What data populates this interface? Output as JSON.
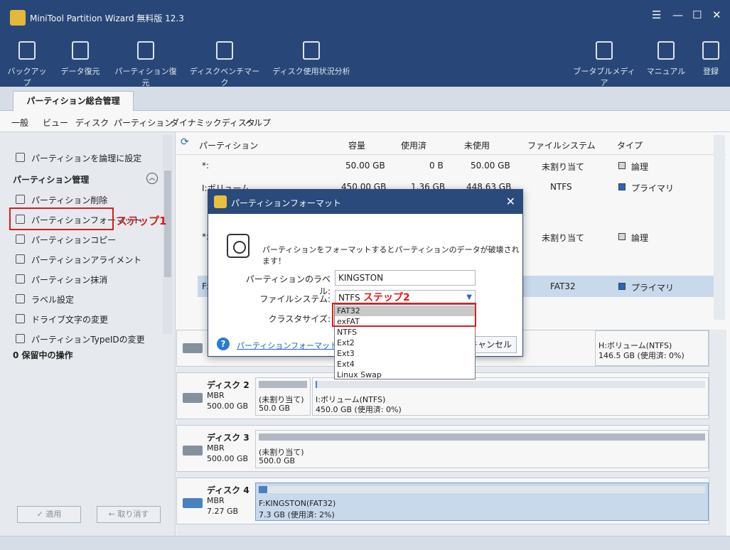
{
  "app": {
    "title": "MiniTool Partition Wizard 無料版 12.3"
  },
  "toolbar": {
    "items": [
      {
        "label": "バックアップ",
        "icon": "backup-icon"
      },
      {
        "label": "データ復元",
        "icon": "data-recovery-icon"
      },
      {
        "label": "パーティション復元",
        "icon": "partition-recovery-icon"
      },
      {
        "label": "ディスクベンチマーク",
        "icon": "disk-benchmark-icon"
      },
      {
        "label": "ディスク使用状況分析",
        "icon": "space-analyzer-icon"
      }
    ],
    "right_items": [
      {
        "label": "ブータブルメディア",
        "icon": "bootable-media-icon"
      },
      {
        "label": "マニュアル",
        "icon": "manual-icon"
      },
      {
        "label": "登録",
        "icon": "register-icon"
      }
    ]
  },
  "tabs": [
    {
      "label": "パーティション総合管理"
    }
  ],
  "menu": [
    "一般",
    "ビュー",
    "ディスク",
    "パーティション",
    "ダイナミックディスク",
    "ヘルプ"
  ],
  "sidebar": {
    "top_items": [
      "パーティションを論理に設定"
    ],
    "section_title": "パーティション管理",
    "items": [
      "パーティション削除",
      "パーティションフォーマット",
      "パーティションコピー",
      "パーティションアライメント",
      "パーティション抹消",
      "ラベル設定",
      "ドライブ文字の変更",
      "パーティションTypeIDの変更"
    ],
    "pending": "0 保留中の操作",
    "apply_label": "✓ 適用",
    "undo_label": "← 取り消す"
  },
  "annotations": {
    "step1": "ステップ1",
    "step2": "ステップ2"
  },
  "grid": {
    "headers": [
      "パーティション",
      "容量",
      "使用済",
      "未使用",
      "ファイルシステム",
      "タイプ"
    ],
    "rows": [
      {
        "name": "*:",
        "cap": "50.00 GB",
        "used": "0 B",
        "free": "50.00 GB",
        "fs": "未割り当て",
        "type": "論理"
      },
      {
        "name": "I:ボリューム",
        "cap": "450.00 GB",
        "used": "1.36 GB",
        "free": "448.63 GB",
        "fs": "NTFS",
        "type": "プライマリ"
      },
      {
        "name": "*:",
        "cap": "",
        "used": "",
        "free": "",
        "fs": "未割り当て",
        "type": "論理"
      },
      {
        "name": "F:",
        "cap": "",
        "used": "",
        "free": "",
        "fs": "FAT32",
        "type": "プライマリ"
      }
    ]
  },
  "disks": [
    {
      "name": "",
      "sub": "",
      "parts": [
        {
          "l1": "H:ボリューム(NTFS)",
          "l2": "146.5 GB (使用済: 0%)"
        }
      ]
    },
    {
      "name": "ディスク 2",
      "sub1": "MBR",
      "sub2": "500.00 GB",
      "parts": [
        {
          "l1": "(未割り当て)",
          "l2": "50.0 GB"
        },
        {
          "l1": "I:ボリューム(NTFS)",
          "l2": "450.0 GB (使用済: 0%)"
        }
      ]
    },
    {
      "name": "ディスク 3",
      "sub1": "MBR",
      "sub2": "500.00 GB",
      "parts": [
        {
          "l1": "(未割り当て)",
          "l2": "500.0 GB"
        }
      ]
    },
    {
      "name": "ディスク 4",
      "sub1": "MBR",
      "sub2": "7.27 GB",
      "parts": [
        {
          "l1": "F:KINGSTON(FAT32)",
          "l2": "7.3 GB (使用済: 2%)"
        }
      ]
    }
  ],
  "dialog": {
    "title": "パーティションフォーマット",
    "warning": "パーティションをフォーマットするとパーティションのデータが破壊されます！",
    "label_field_label": "パーティションのラベル:",
    "label_value": "KINGSTON",
    "fs_label": "ファイルシステム:",
    "fs_value": "NTFS",
    "cluster_label": "クラスタサイズ:",
    "help_link": "パーティションフォーマットのチュ",
    "cancel_label": "キャンセル",
    "fs_options": [
      "FAT32",
      "exFAT",
      "NTFS",
      "Ext2",
      "Ext3",
      "Ext4",
      "Linux Swap"
    ]
  }
}
